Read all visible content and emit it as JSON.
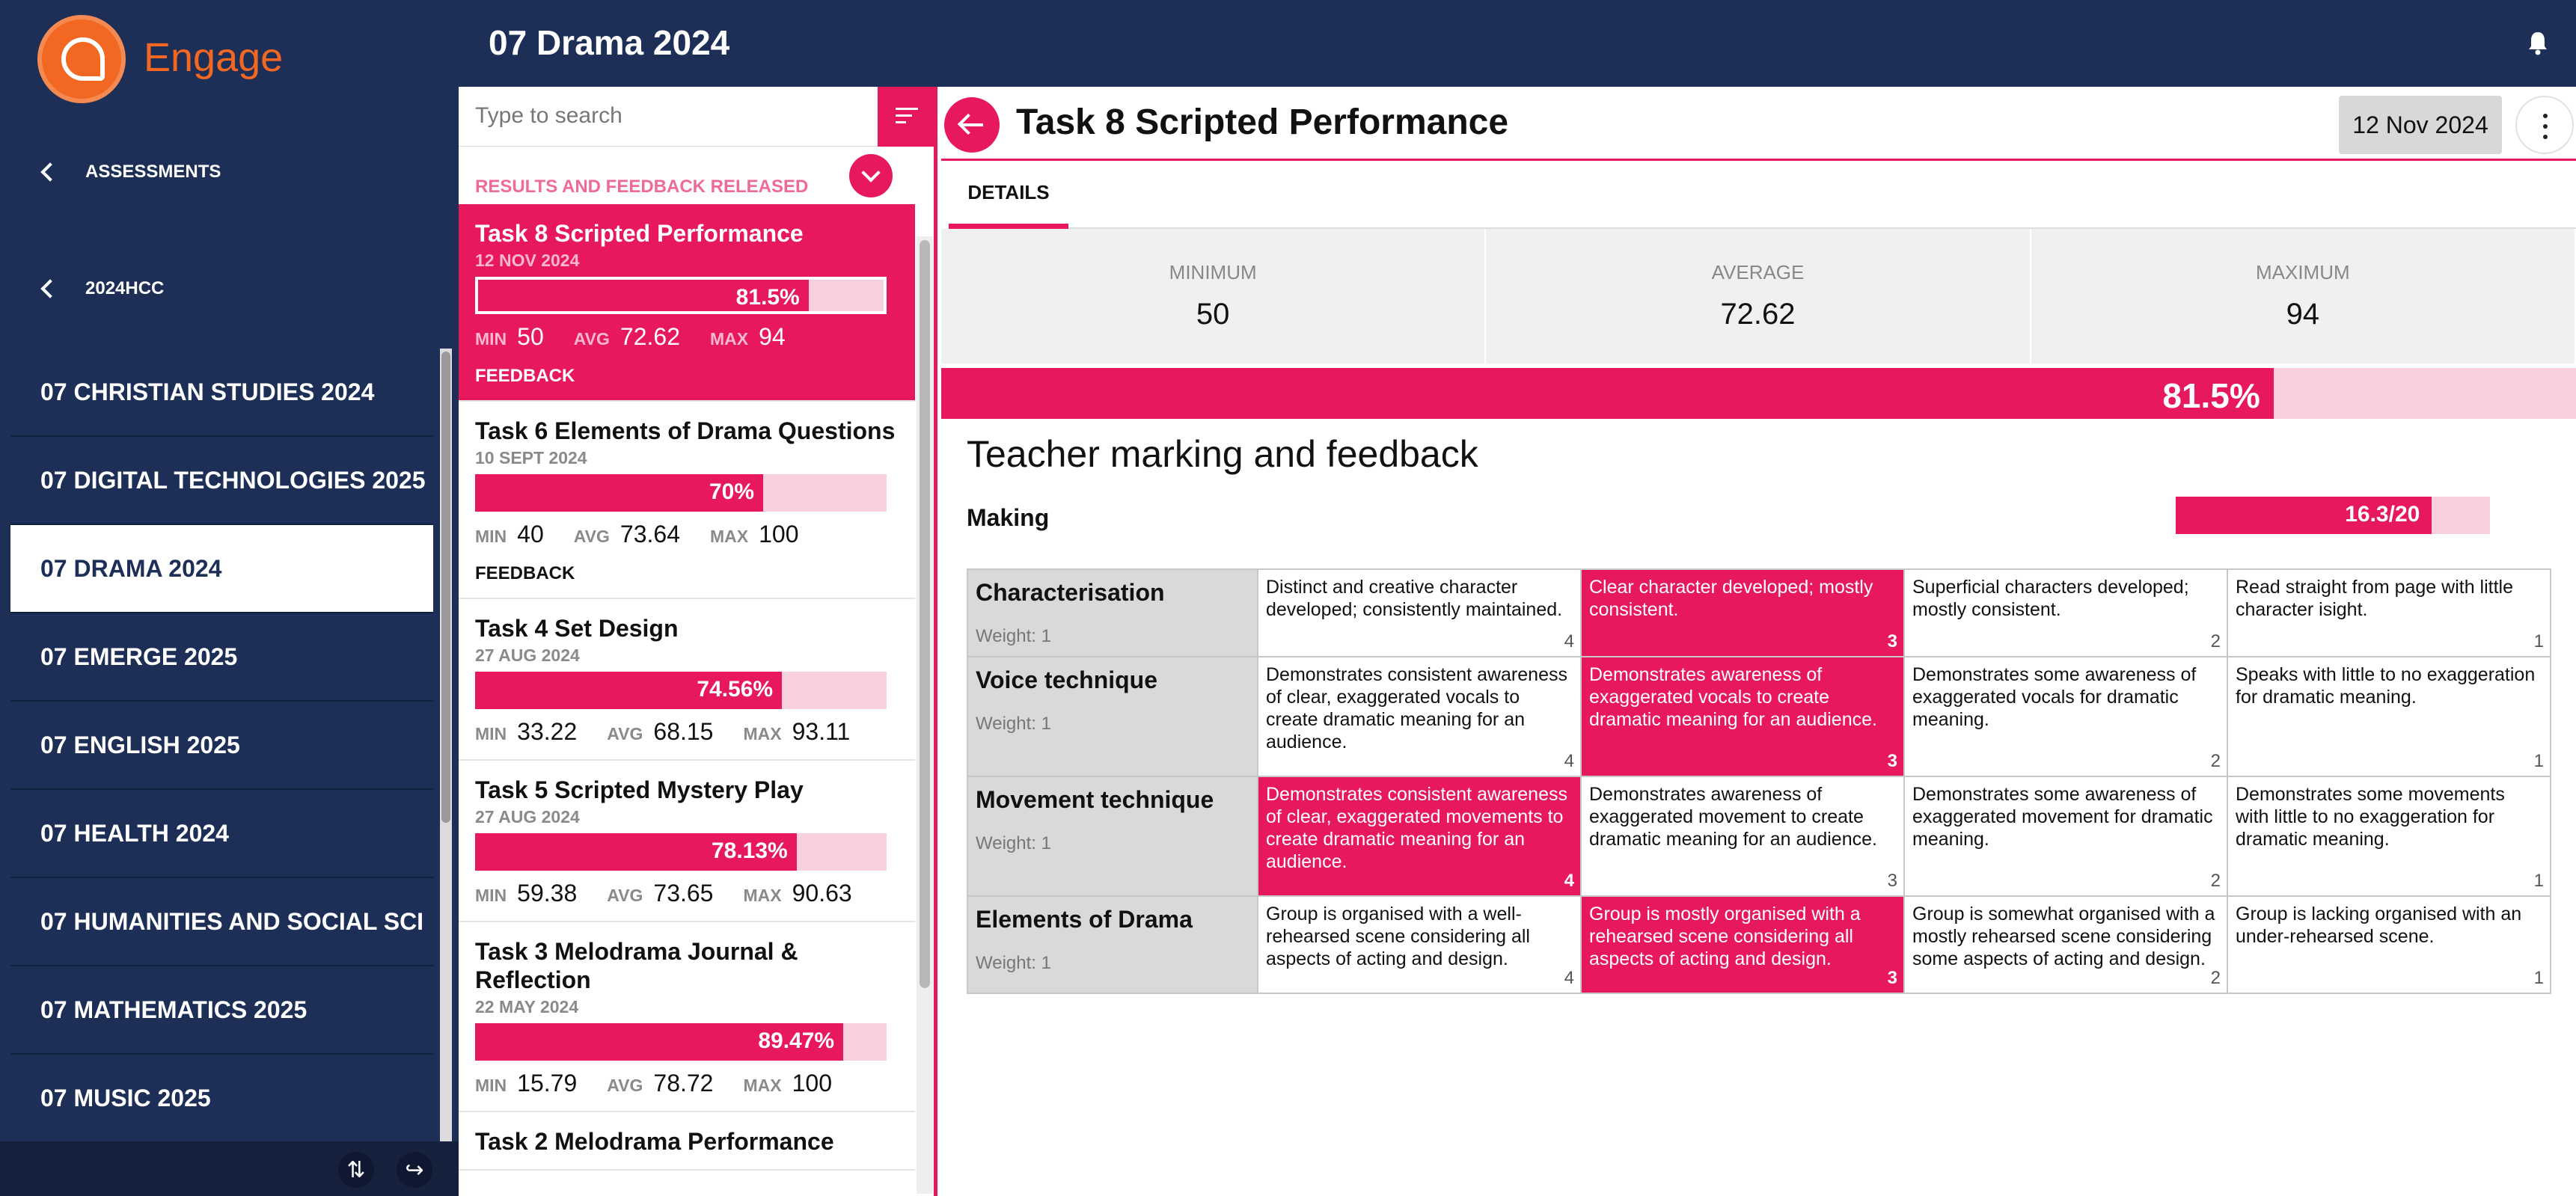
{
  "app": {
    "brand": "Engage"
  },
  "nav": {
    "back_assessments": "ASSESSMENTS",
    "back_year": "2024HCC",
    "courses": [
      {
        "label": "07 CHRISTIAN STUDIES 2024",
        "active": false
      },
      {
        "label": "07 DIGITAL TECHNOLOGIES 2025",
        "active": false
      },
      {
        "label": "07 DRAMA 2024",
        "active": true
      },
      {
        "label": "07 EMERGE 2025",
        "active": false
      },
      {
        "label": "07 ENGLISH 2025",
        "active": false
      },
      {
        "label": "07 HEALTH 2024",
        "active": false
      },
      {
        "label": "07 HUMANITIES AND SOCIAL SCI",
        "active": false
      },
      {
        "label": "07 MATHEMATICS 2025",
        "active": false
      },
      {
        "label": "07 MUSIC 2025",
        "active": false
      }
    ]
  },
  "header": {
    "title": "07 Drama 2024",
    "icon": "bell-icon"
  },
  "list": {
    "search_placeholder": "Type to search",
    "status_label": "RESULTS AND FEEDBACK RELEASED",
    "stat_labels": {
      "min": "MIN",
      "avg": "AVG",
      "max": "MAX"
    },
    "tasks": [
      {
        "name": "Task 8 Scripted Performance",
        "date": "12 NOV 2024",
        "pct_label": "81.5%",
        "pct": 81.5,
        "min": "50",
        "avg": "72.62",
        "max": "94",
        "feedback": "FEEDBACK",
        "selected": true
      },
      {
        "name": "Task 6 Elements of Drama Questions",
        "date": "10 SEPT 2024",
        "pct_label": "70%",
        "pct": 70,
        "min": "40",
        "avg": "73.64",
        "max": "100",
        "feedback": "FEEDBACK",
        "selected": false
      },
      {
        "name": "Task 4 Set Design",
        "date": "27 AUG 2024",
        "pct_label": "74.56%",
        "pct": 74.56,
        "min": "33.22",
        "avg": "68.15",
        "max": "93.11",
        "feedback": "",
        "selected": false
      },
      {
        "name": "Task 5 Scripted Mystery Play",
        "date": "27 AUG 2024",
        "pct_label": "78.13%",
        "pct": 78.13,
        "min": "59.38",
        "avg": "73.65",
        "max": "90.63",
        "feedback": "",
        "selected": false
      },
      {
        "name": "Task 3 Melodrama Journal & Reflection",
        "date": "22 MAY 2024",
        "pct_label": "89.47%",
        "pct": 89.47,
        "min": "15.79",
        "avg": "78.72",
        "max": "100",
        "feedback": "",
        "selected": false
      },
      {
        "name": "Task 2 Melodrama Performance",
        "date": "",
        "pct_label": "",
        "pct": 0,
        "min": "",
        "avg": "",
        "max": "",
        "feedback": "",
        "selected": false
      }
    ]
  },
  "detail": {
    "title": "Task 8 Scripted Performance",
    "date": "12 Nov 2024",
    "tab": "DETAILS",
    "stats": [
      {
        "label": "MINIMUM",
        "value": "50"
      },
      {
        "label": "AVERAGE",
        "value": "72.62"
      },
      {
        "label": "MAXIMUM",
        "value": "94"
      }
    ],
    "overall_label": "81.5%",
    "overall_pct": 81.5,
    "section_title": "Teacher marking and feedback",
    "criterion_group": "Making",
    "criterion_score_label": "16.3/20",
    "criterion_score_pct": 81.5,
    "rubric": [
      {
        "name": "Characterisation",
        "weight": "Weight: 1",
        "selected": 1,
        "levels": [
          {
            "text": "Distinct and creative character developed; consistently maintained.",
            "score": "4"
          },
          {
            "text": "Clear character developed; mostly consistent.",
            "score": "3"
          },
          {
            "text": "Superficial characters developed; mostly consistent.",
            "score": "2"
          },
          {
            "text": "Read straight from page with little character isight.",
            "score": "1"
          }
        ]
      },
      {
        "name": "Voice technique",
        "weight": "Weight: 1",
        "selected": 1,
        "levels": [
          {
            "text": "Demonstrates consistent awareness of clear, exaggerated vocals to create dramatic meaning for an audience.",
            "score": "4"
          },
          {
            "text": "Demonstrates awareness of exaggerated vocals to create dramatic meaning for an audience.",
            "score": "3"
          },
          {
            "text": "Demonstrates some awareness of exaggerated vocals for dramatic meaning.",
            "score": "2"
          },
          {
            "text": "Speaks with little to no exaggeration for dramatic meaning.",
            "score": "1"
          }
        ]
      },
      {
        "name": "Movement technique",
        "weight": "Weight: 1",
        "selected": 0,
        "levels": [
          {
            "text": "Demonstrates consistent awareness of clear, exaggerated movements to create dramatic meaning for an audience.",
            "score": "4"
          },
          {
            "text": "Demonstrates awareness of exaggerated movement to create dramatic meaning for an audience.",
            "score": "3"
          },
          {
            "text": "Demonstrates some awareness of exaggerated movement for dramatic meaning.",
            "score": "2"
          },
          {
            "text": "Demonstrates some movements with little to no exaggeration for dramatic meaning.",
            "score": "1"
          }
        ]
      },
      {
        "name": "Elements of Drama",
        "weight": "Weight: 1",
        "selected": 1,
        "levels": [
          {
            "text": "Group is organised with a well-rehearsed scene considering all aspects of acting and design.",
            "score": "4"
          },
          {
            "text": "Group is mostly organised with a rehearsed scene considering all aspects of acting and design.",
            "score": "3"
          },
          {
            "text": "Group is somewhat organised with a mostly rehearsed scene considering some aspects of acting and design.",
            "score": "2"
          },
          {
            "text": "Group is lacking organised with an under-rehearsed scene.",
            "score": "1"
          }
        ]
      }
    ]
  },
  "footer": {
    "icons": [
      "thumbs-icon",
      "logout-icon"
    ]
  },
  "colors": {
    "accent": "#e8185e",
    "navy": "#1d2f57",
    "brand": "#f26722"
  }
}
